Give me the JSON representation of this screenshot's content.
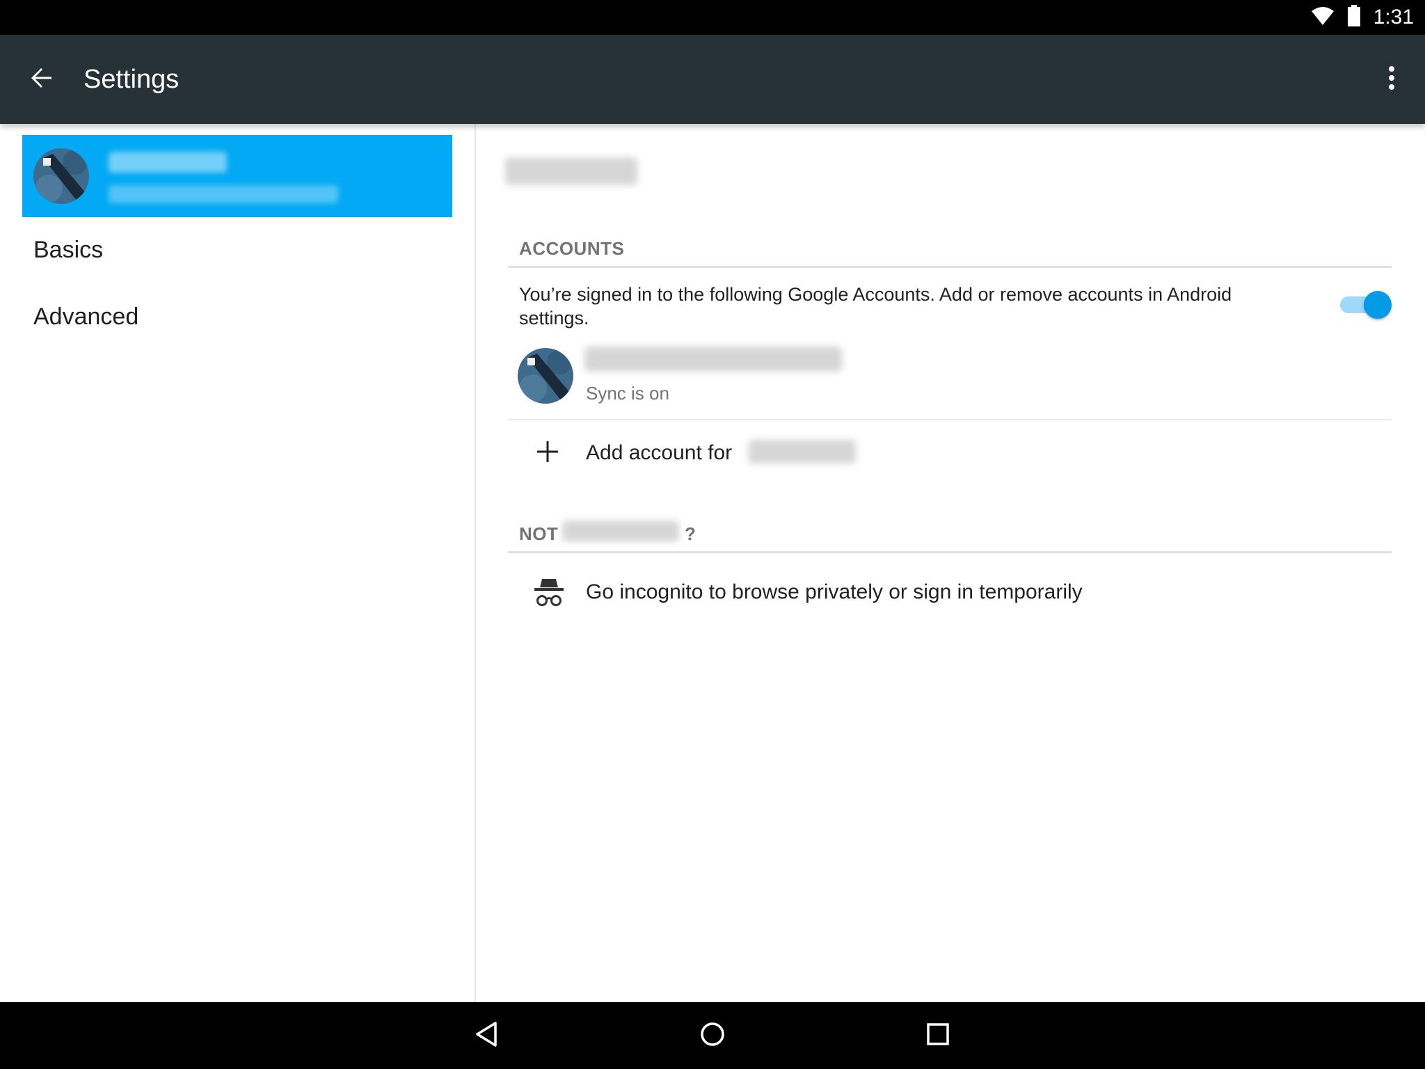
{
  "status_bar": {
    "time": "1:31",
    "icons": [
      "wifi-icon",
      "battery-icon"
    ]
  },
  "toolbar": {
    "title": "Settings",
    "back_icon": "arrow-back-icon",
    "overflow_icon": "more-vert-icon"
  },
  "sidebar": {
    "items": [
      {
        "label": "Basics"
      },
      {
        "label": "Advanced"
      }
    ]
  },
  "accounts": {
    "section_title": "ACCOUNTS",
    "description": "You’re signed in to the following Google Accounts. Add or remove accounts in Android settings.",
    "sync_toggle": "on",
    "account_status": "Sync is on",
    "add_account_label": "Add account for"
  },
  "not_section": {
    "title_prefix": "NOT",
    "title_suffix": "?",
    "incognito_label": "Go incognito to browse privately or sign in temporarily"
  },
  "colors": {
    "toolbar": "#263238",
    "profile_header": "#03a9f4",
    "toggle_thumb": "#039be5",
    "toggle_track": "#9fd8f8"
  }
}
